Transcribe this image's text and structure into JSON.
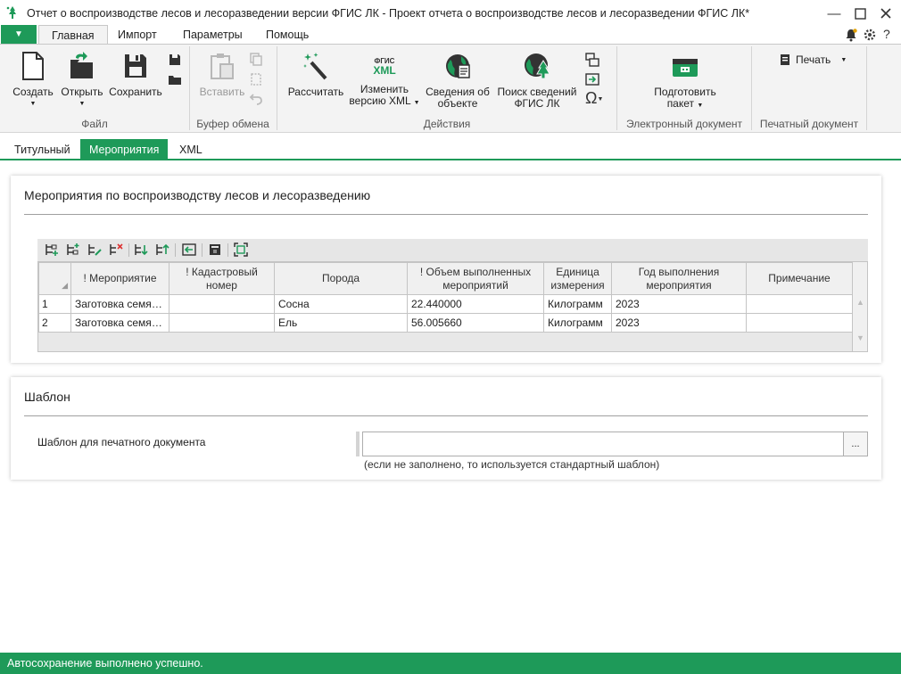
{
  "window": {
    "title": "Отчет о воспроизводстве лесов и лесоразведении версии ФГИС ЛК - Проект отчета о воспроизводстве лесов и лесоразведении ФГИС ЛК*"
  },
  "menu": {
    "file_glyph": "▼",
    "tabs": [
      {
        "label": "Главная",
        "active": true
      },
      {
        "label": "Импорт"
      },
      {
        "label": "Параметры"
      },
      {
        "label": "Помощь"
      }
    ]
  },
  "ribbon": {
    "file_group": {
      "label": "Файл",
      "create": "Создать",
      "open": "Открыть",
      "save": "Сохранить"
    },
    "clipboard_group": {
      "label": "Буфер обмена",
      "paste": "Вставить"
    },
    "actions_group": {
      "label": "Действия",
      "calculate": "Рассчитать",
      "change_xml_1": "Изменить",
      "change_xml_2": "версию XML",
      "fgis_xml_icon_top": "ФГИС",
      "fgis_xml_icon_bottom": "XML",
      "object_info_1": "Сведения об",
      "object_info_2": "объекте",
      "search_fgis_1": "Поиск сведений",
      "search_fgis_2": "ФГИС ЛК"
    },
    "edoc_group": {
      "label": "Электронный документ",
      "prepare_1": "Подготовить",
      "prepare_2": "пакет"
    },
    "print_group": {
      "label": "Печатный документ",
      "print": "Печать"
    }
  },
  "doc_tabs": [
    {
      "label": "Титульный"
    },
    {
      "label": "Мероприятия",
      "active": true
    },
    {
      "label": "XML"
    }
  ],
  "measures_panel": {
    "title": "Мероприятия по воспроизводству лесов и лесоразведению",
    "columns": [
      "! Мероприятие",
      "! Кадастровый номер",
      "Порода",
      "! Объем выполненных мероприятий",
      "Единица измерения",
      "Год выполнения мероприятия",
      "Примечание"
    ],
    "rows": [
      {
        "num": "1",
        "measure": "Заготовка семян лесных растений",
        "cadastral": "",
        "species": "Сосна",
        "volume": "22.440000",
        "unit": "Килограмм",
        "year": "2023",
        "note": ""
      },
      {
        "num": "2",
        "measure": "Заготовка семян лесных растений",
        "cadastral": "",
        "species": "Ель",
        "volume": "56.005660",
        "unit": "Килограмм",
        "year": "2023",
        "note": ""
      }
    ]
  },
  "template_panel": {
    "title": "Шаблон",
    "field_label": "Шаблон для печатного документа",
    "field_value": "",
    "browse_label": "...",
    "hint": "(если не заполнено, то используется стандартный шаблон)"
  },
  "status": {
    "text": "Автосохранение выполнено успешно."
  },
  "colors": {
    "accent": "#1e9a59"
  }
}
